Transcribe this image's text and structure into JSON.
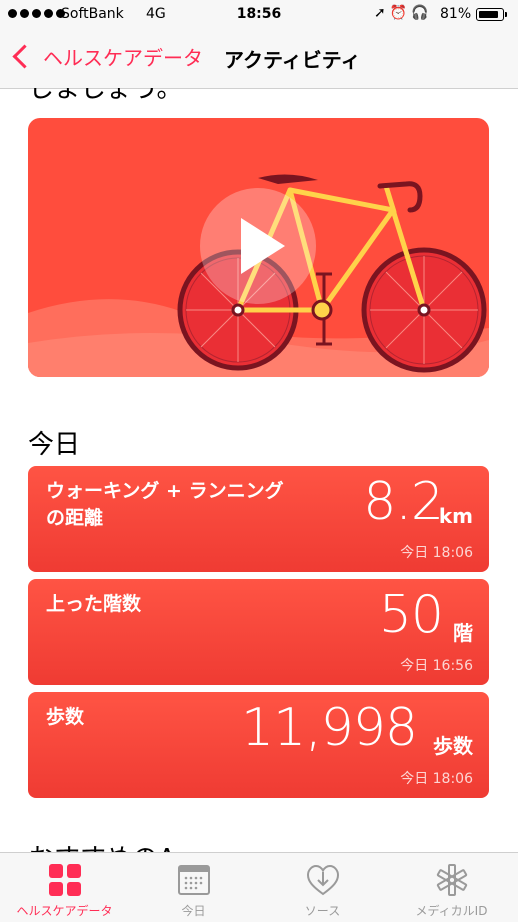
{
  "status_bar": {
    "carrier": "SoftBank",
    "network": "4G",
    "time": "18:56",
    "icons": [
      "location-arrow-icon",
      "alarm-icon",
      "headphones-icon"
    ],
    "battery_percent_label": "81%",
    "battery_level": 0.81
  },
  "nav": {
    "back_label": "ヘルスケアデータ",
    "title": "アクティビティ",
    "accent_color": "#ff2d55"
  },
  "scrolled_heading": "しましょう。",
  "video": {
    "icon": "play-icon",
    "background_color": "#ff4d3d"
  },
  "today": {
    "heading": "今日",
    "cards": [
      {
        "label_line1": "ウォーキング + ランニング",
        "label_line2": "の距離",
        "value": "8.2",
        "unit": "km",
        "time": "今日 18:06"
      },
      {
        "label_line1": "上った階数",
        "label_line2": "",
        "value": "50",
        "unit": "階",
        "time": "今日 16:56"
      },
      {
        "label_line1": "歩数",
        "label_line2": "",
        "value": "11,998",
        "unit": "歩数",
        "time": "今日 18:06"
      }
    ],
    "card_color": "#f4433a"
  },
  "next_heading": "おすすめのA",
  "tabbar": {
    "items": [
      {
        "label": "ヘルスケアデータ",
        "icon": "grid-icon",
        "active": true
      },
      {
        "label": "今日",
        "icon": "calendar-icon",
        "active": false
      },
      {
        "label": "ソース",
        "icon": "download-heart-icon",
        "active": false
      },
      {
        "label": "メディカルID",
        "icon": "medical-star-icon",
        "active": false
      }
    ]
  }
}
